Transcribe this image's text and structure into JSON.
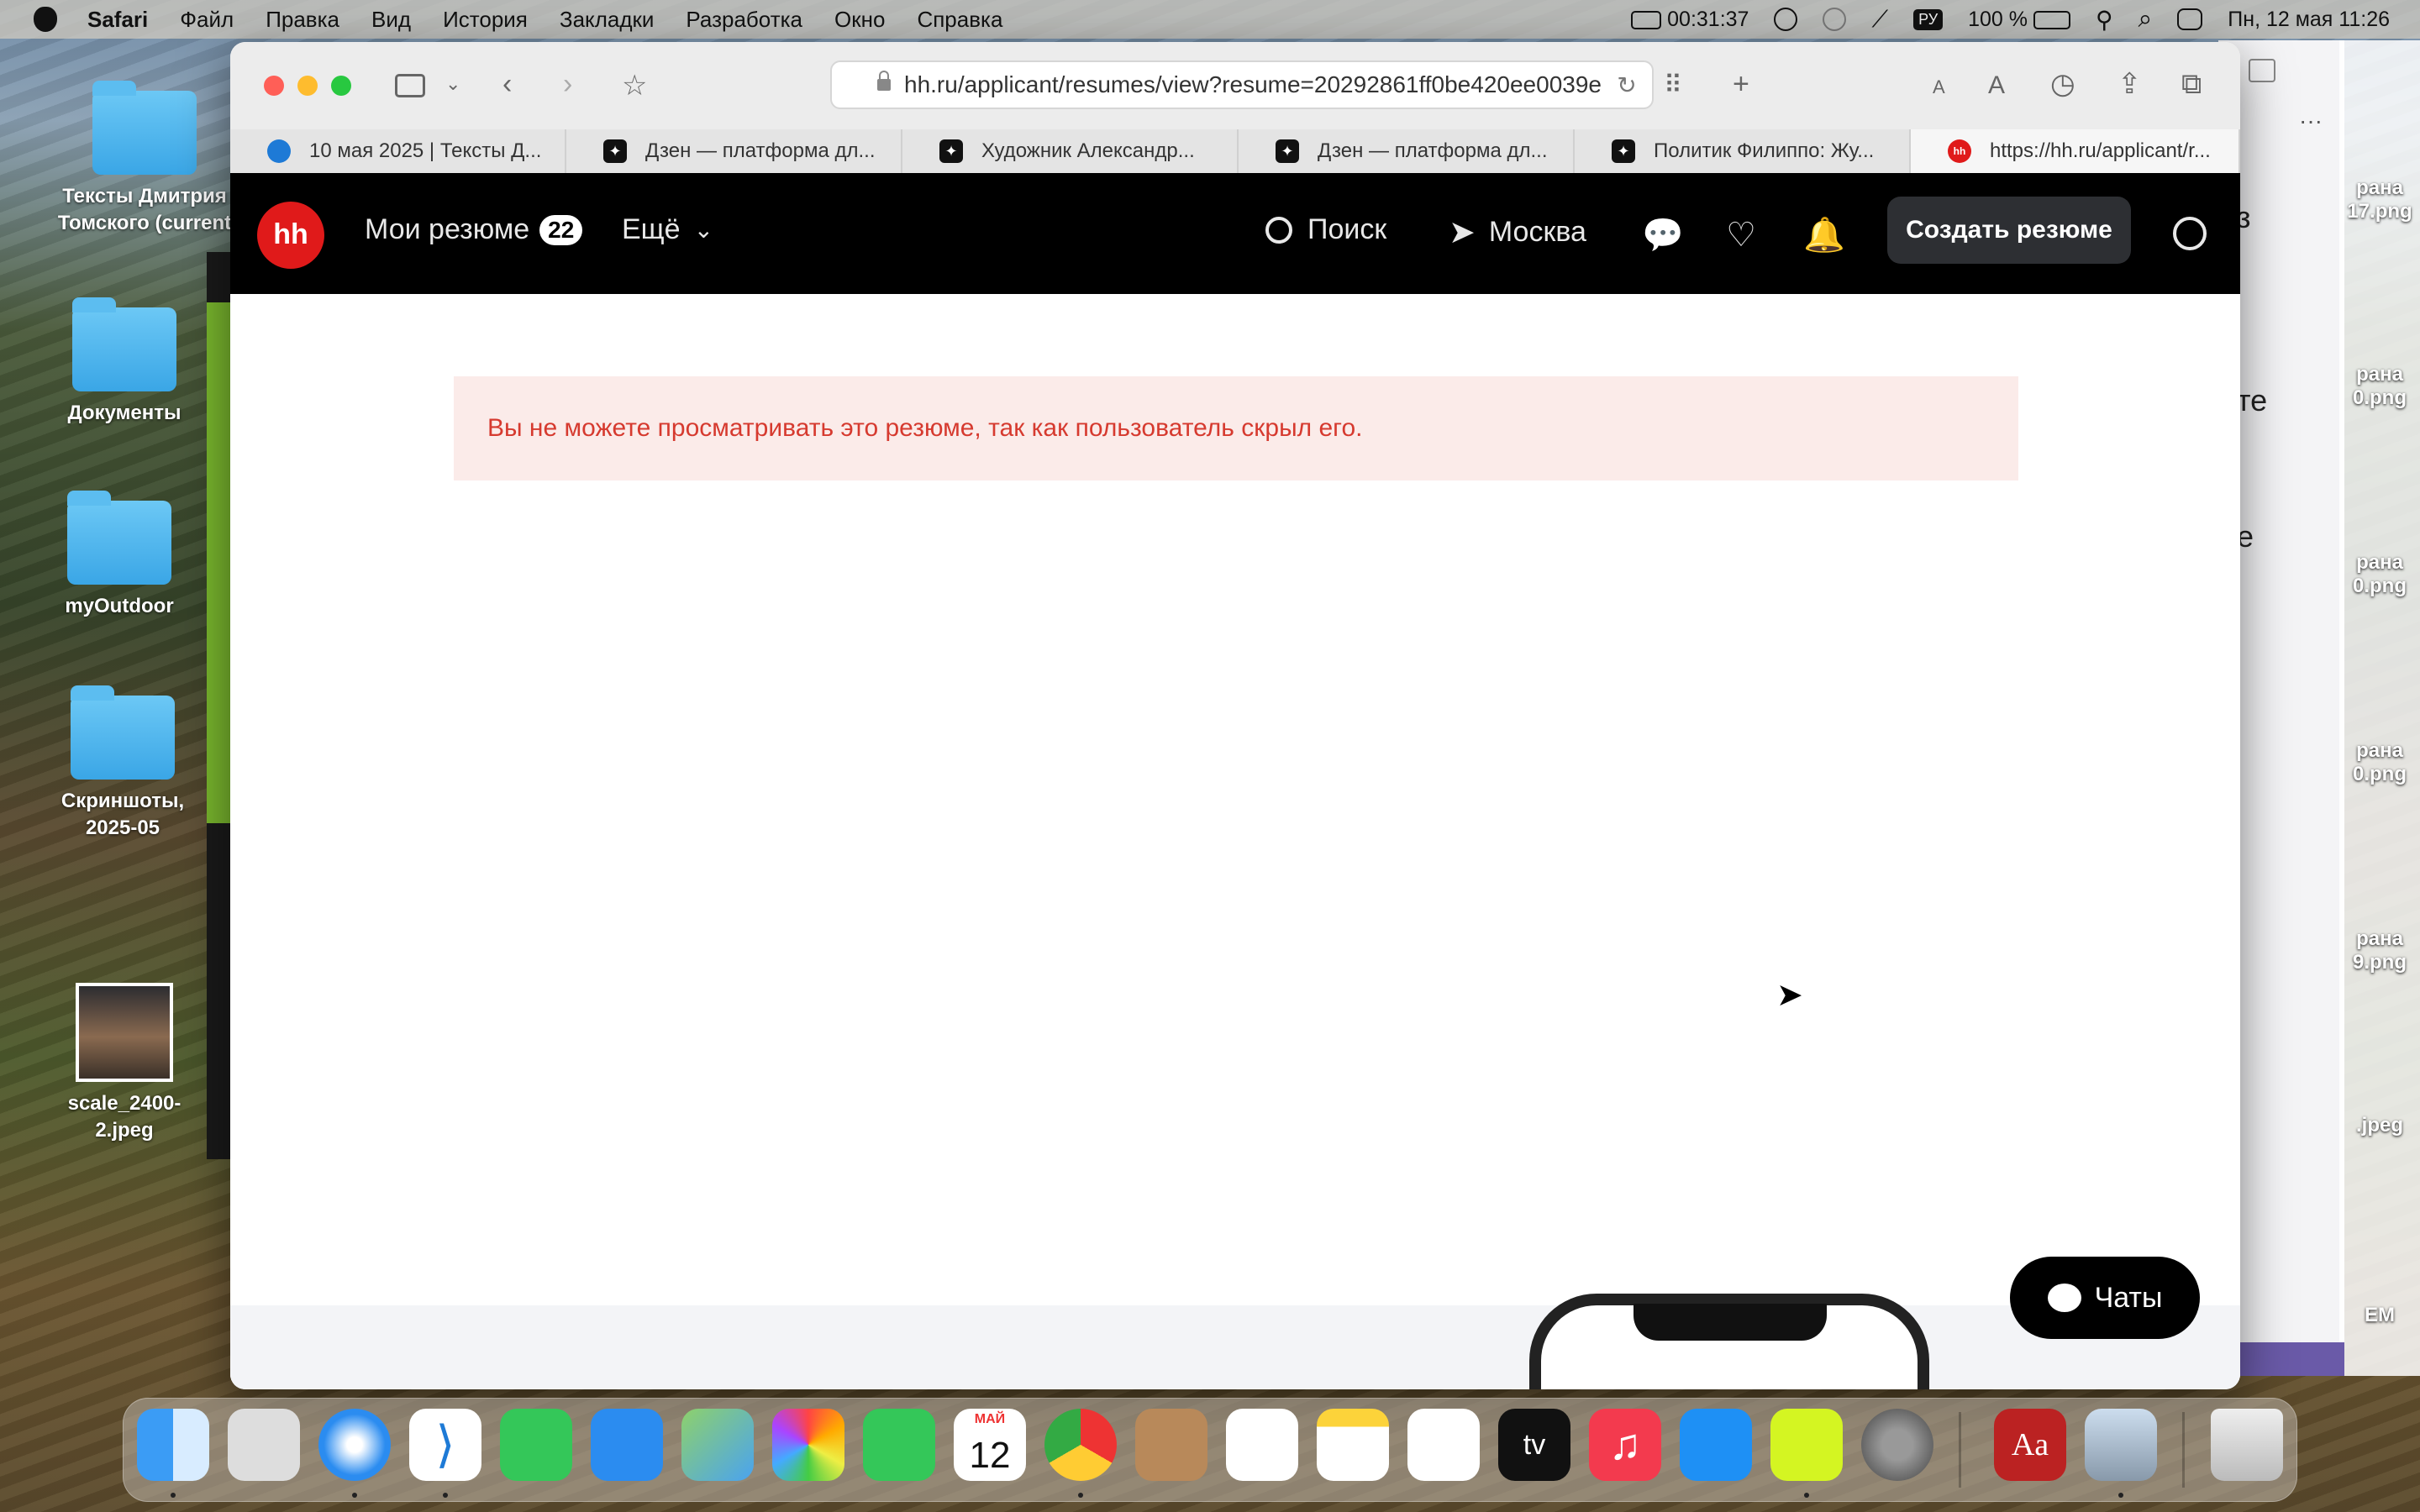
{
  "menubar": {
    "app": "Safari",
    "items": [
      "Файл",
      "Правка",
      "Вид",
      "История",
      "Закладки",
      "Разработка",
      "Окно",
      "Справка"
    ],
    "timer": "00:31:37",
    "input_source": "РУ",
    "battery": "100 %",
    "datetime": "Пн, 12 мая  11:26"
  },
  "desktop": {
    "icons": [
      {
        "label": "Тексты Дмитрия Томского (current"
      },
      {
        "label": "Документы"
      },
      {
        "label": "myOutdoor"
      },
      {
        "label": "Скриншоты, 2025-05"
      },
      {
        "label": "scale_2400-2.jpeg"
      }
    ],
    "peek_text": [
      "з",
      "те",
      "е"
    ],
    "peek_files": [
      "рана\n17.png",
      "рана\n0.png",
      "рана\n0.png",
      "рана\n0.png",
      "рана\n9.png",
      ".jpeg",
      "EM"
    ]
  },
  "browser": {
    "url": "hh.ru/applicant/resumes/view?resume=20292861ff0be420ee0039e",
    "tabs": [
      {
        "title": "10 мая 2025 | Тексты Д...",
        "icon": "drupal-icon"
      },
      {
        "title": "Дзен — платформа дл...",
        "icon": "dzen-icon"
      },
      {
        "title": "Художник Александр...",
        "icon": "dzen-icon"
      },
      {
        "title": "Дзен — платформа дл...",
        "icon": "dzen-icon"
      },
      {
        "title": "Политик Филиппо: Жу...",
        "icon": "dzen-icon"
      },
      {
        "title": "https://hh.ru/applicant/r...",
        "icon": "hh-icon",
        "active": true
      }
    ]
  },
  "hh": {
    "logo": "hh",
    "my_resumes": "Мои резюме",
    "resume_count": "22",
    "more": "Ещё",
    "search": "Поиск",
    "city": "Москва",
    "create_resume": "Создать резюме",
    "alert": "Вы не можете просматривать это резюме, так как пользователь скрыл его.",
    "chats": "Чаты"
  },
  "dock": {
    "calendar_month": "МАЙ",
    "calendar_day": "12",
    "tv_label": "tv",
    "dictionary_label": "Aa"
  }
}
